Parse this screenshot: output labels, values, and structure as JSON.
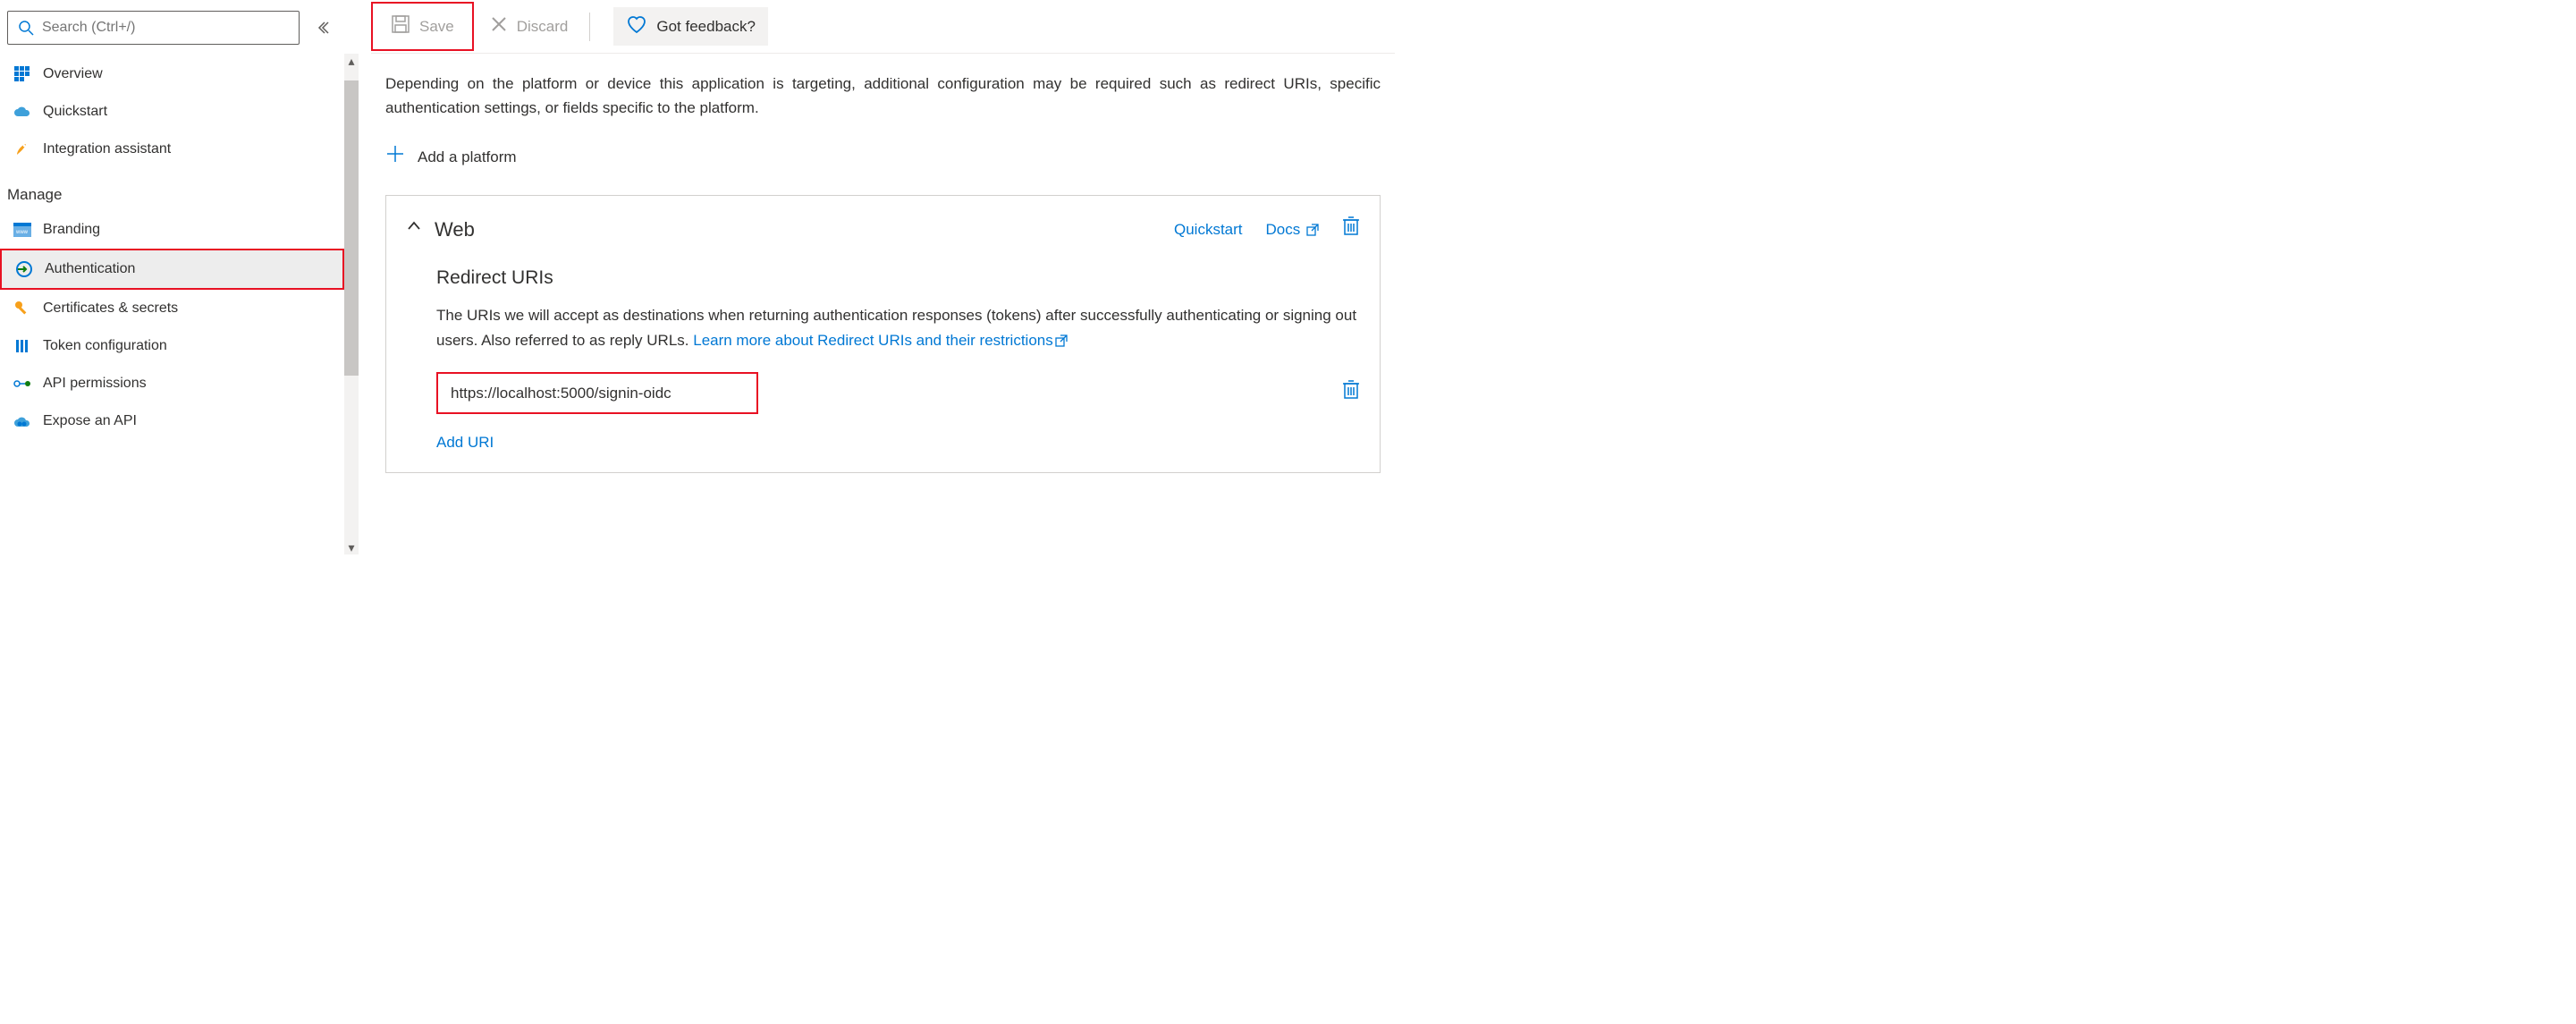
{
  "sidebar": {
    "search_placeholder": "Search (Ctrl+/)",
    "items_top": [
      {
        "label": "Overview"
      },
      {
        "label": "Quickstart"
      },
      {
        "label": "Integration assistant"
      }
    ],
    "section_label": "Manage",
    "items_manage": [
      {
        "label": "Branding"
      },
      {
        "label": "Authentication",
        "active": true
      },
      {
        "label": "Certificates & secrets"
      },
      {
        "label": "Token configuration"
      },
      {
        "label": "API permissions"
      },
      {
        "label": "Expose an API"
      }
    ]
  },
  "toolbar": {
    "save_label": "Save",
    "discard_label": "Discard",
    "feedback_label": "Got feedback?"
  },
  "content": {
    "description": "Depending on the platform or device this application is targeting, additional configuration may be required such as redirect URIs, specific authentication settings, or fields specific to the platform.",
    "add_platform_label": "Add a platform"
  },
  "panel": {
    "title": "Web",
    "quickstart_link": "Quickstart",
    "docs_link": "Docs",
    "subsection_title": "Redirect URIs",
    "text_part1": "The URIs we will accept as destinations when returning authentication responses (tokens) after successfully authenticating or signing out users. Also referred to as reply URLs. ",
    "learn_more_link": "Learn more about Redirect URIs and their restrictions",
    "uri_value": "https://localhost:5000/signin-oidc",
    "add_uri_label": "Add URI"
  }
}
